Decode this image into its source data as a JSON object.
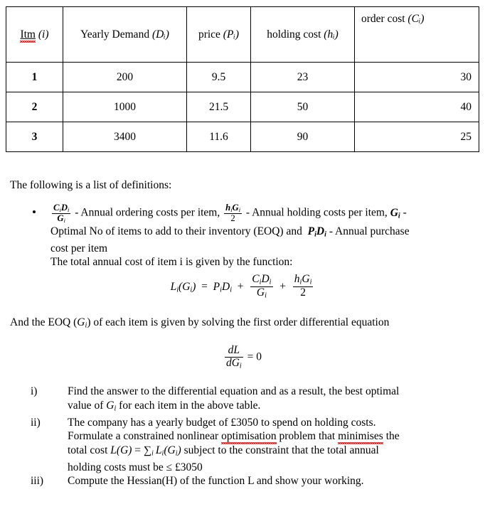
{
  "table": {
    "headers": [
      {
        "label": "Itm",
        "sub": "(i)",
        "misspelled": true,
        "underlined": true,
        "align": "center"
      },
      {
        "label": "Yearly Demand",
        "sub": "(Dᵢ)",
        "misspelled": false,
        "underlined": false,
        "align": "center"
      },
      {
        "label": "price",
        "sub": "(Pᵢ)",
        "misspelled": false,
        "underlined": false,
        "align": "center"
      },
      {
        "label": "holding cost",
        "sub": "(hᵢ)",
        "misspelled": false,
        "underlined": false,
        "align": "center"
      },
      {
        "label": "order cost",
        "sub": "(Cᵢ)",
        "misspelled": false,
        "underlined": false,
        "align": "top-left"
      }
    ],
    "rows": [
      {
        "item": "1",
        "demand": "200",
        "price": "9.5",
        "holding": "23",
        "order": "30"
      },
      {
        "item": "2",
        "demand": "1000",
        "price": "21.5",
        "holding": "50",
        "order": "40"
      },
      {
        "item": "3",
        "demand": "3400",
        "price": "11.6",
        "holding": "90",
        "order": "25"
      }
    ]
  },
  "definitions": {
    "heading": "The following is a list of definitions:",
    "bullet": {
      "ordering_desc": "- Annual ordering costs per item,",
      "holding_desc": "- Annual holding costs per item,",
      "g_desc": "-",
      "line2": "Optimal No of items to add to their inventory (EOQ) and",
      "purchase_desc": "- Annual purchase",
      "line3": "cost per item"
    },
    "function_intro": "The total annual cost of item i is given by the function:"
  },
  "eoq": {
    "intro_before": "And the EOQ",
    "intro_after": "of each item is given by solving the first order differential equation",
    "ode_rhs": "= 0"
  },
  "questions": [
    {
      "marker": "i)",
      "lines": [
        "Find the answer to the differential equation and as a result, the best optimal",
        "value of Gᵢ for each item in the above table."
      ]
    },
    {
      "marker": "ii)",
      "lines": [
        "The company has a yearly budget of £3050 to spend on holding costs.",
        "Formulate a constrained nonlinear optimisation problem that minimises the",
        "total cost L(G) = ∑ᵢ Lᵢ(Gᵢ) subject to the constraint that the total annual",
        "holding costs must be ≤ £3050"
      ],
      "misspelled_words": [
        "optimisation",
        "minimises"
      ],
      "budget": "£3050",
      "constraint_limit": "£3050"
    },
    {
      "marker": "iii)",
      "lines": [
        "Compute the Hessian(H) of the function L and show your working."
      ]
    }
  ],
  "colors": {
    "text": "#000000",
    "background": "#ffffff",
    "table_border": "#000000",
    "spellcheck_underline": "#e02020"
  }
}
